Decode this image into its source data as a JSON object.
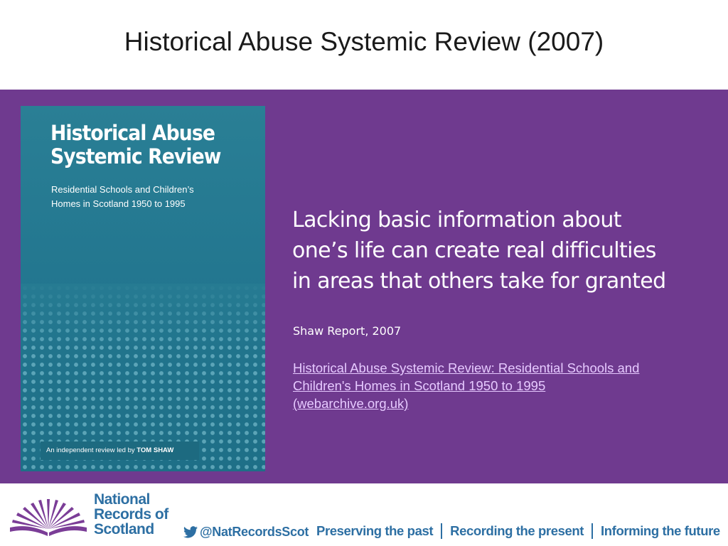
{
  "slide": {
    "title": "Historical Abuse Systemic Review (2007)"
  },
  "cover": {
    "title_line1": "Historical Abuse",
    "title_line2": "Systemic Review",
    "subtitle_line1": "Residential Schools and Children’s",
    "subtitle_line2": "Homes in Scotland 1950 to 1995",
    "footer_text": "An independent review led by ",
    "footer_name": "TOM SHAW"
  },
  "quote": {
    "line1": "Lacking basic information about",
    "line2": "one’s life can create real difficulties",
    "line3": "in areas that others take for granted",
    "attribution": "Shaw Report, 2007"
  },
  "link": {
    "line1": "Historical Abuse Systemic Review: Residential Schools and",
    "line2": "Children's Homes in Scotland 1950 to 1995",
    "line3": "(webarchive.org.uk)"
  },
  "footer": {
    "logo_line1": "National",
    "logo_line2": "Records of",
    "logo_line3": "Scotland",
    "twitter_handle": "@NatRecordsScot",
    "tagline_1": "Preserving the past",
    "tagline_2": "Recording the present",
    "tagline_3": "Informing the future"
  },
  "colors": {
    "purple_band": "#6f3a8f",
    "cover_teal": "#237790",
    "brand_blue": "#2d6fa3",
    "logo_purple": "#7b3d97",
    "link": "#e6c9ff"
  },
  "icons": [
    "nrs-logo-icon",
    "twitter-icon"
  ]
}
